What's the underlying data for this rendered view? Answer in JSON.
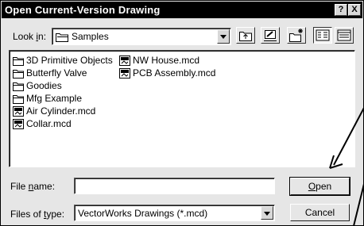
{
  "dialog": {
    "title": "Open Current-Version Drawing",
    "help_button": "?",
    "close_button": "X"
  },
  "look_in": {
    "label_prefix": "Look ",
    "label_underlined": "i",
    "label_suffix": "n:",
    "value": "Samples"
  },
  "toolbar": {
    "buttons": [
      "up-one-level-icon",
      "desktop-icon",
      "new-folder-icon",
      "list-view-icon",
      "details-view-icon"
    ],
    "pressed": "list-view-icon"
  },
  "files": {
    "column1": [
      {
        "name": "3D Primitive Objects",
        "type": "folder"
      },
      {
        "name": "Butterfly Valve",
        "type": "folder"
      },
      {
        "name": "Goodies",
        "type": "folder"
      },
      {
        "name": "Mfg Example",
        "type": "folder"
      },
      {
        "name": "Air Cylinder.mcd",
        "type": "file"
      },
      {
        "name": "Collar.mcd",
        "type": "file"
      }
    ],
    "column2": [
      {
        "name": "NW House.mcd",
        "type": "file"
      },
      {
        "name": "PCB Assembly.mcd",
        "type": "file"
      }
    ]
  },
  "file_name": {
    "label_prefix": "File ",
    "label_underlined": "n",
    "label_suffix": "ame:",
    "value": ""
  },
  "file_type": {
    "label_prefix": "Files of ",
    "label_underlined": "t",
    "label_suffix": "ype:",
    "value": "VectorWorks Drawings (*.mcd)"
  },
  "buttons": {
    "open_underlined": "O",
    "open_rest": "pen",
    "cancel": "Cancel"
  }
}
